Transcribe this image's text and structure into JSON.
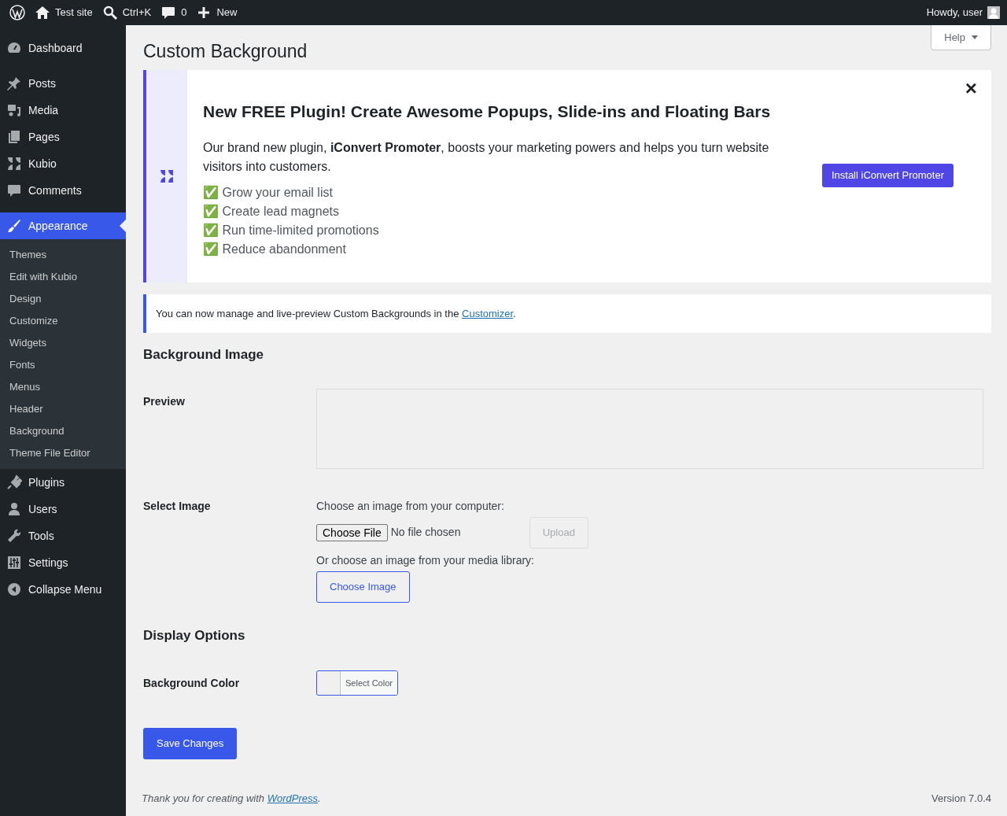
{
  "admin_bar": {
    "items": [
      {
        "kind": "logo"
      },
      {
        "kind": "home",
        "label": "Test site"
      },
      {
        "kind": "search",
        "label": "Ctrl+K"
      },
      {
        "kind": "comment",
        "label": "0"
      },
      {
        "kind": "plus",
        "label": "New"
      }
    ],
    "greeting": "Howdy, user"
  },
  "sidebar": {
    "items": [
      {
        "label": "Dashboard",
        "selected": false
      },
      {
        "label": "Posts",
        "selected": false
      },
      {
        "label": "Media",
        "selected": false
      },
      {
        "label": "Pages",
        "selected": false
      },
      {
        "label": "Kubio",
        "selected": false
      },
      {
        "label": "Comments",
        "selected": false
      },
      {
        "label": "Appearance",
        "selected": true,
        "submenu": [
          "Themes",
          "Edit with Kubio",
          "Design",
          "Customize",
          "Widgets",
          "Fonts",
          "Menus",
          "Header",
          "Background",
          "Theme File Editor"
        ]
      },
      {
        "label": "Plugins",
        "selected": false
      },
      {
        "label": "Users",
        "selected": false
      },
      {
        "label": "Tools",
        "selected": false
      },
      {
        "label": "Settings",
        "selected": false
      },
      {
        "label": "Collapse Menu",
        "selected": false
      }
    ]
  },
  "help_button": "Help",
  "page_title": "Custom Background",
  "promo": {
    "title": "New FREE Plugin! Create Awesome Popups, Slide-ins and Floating Bars",
    "body": "Our brand new plugin, **iConvert Promoter**, boosts your marketing powers and helps you turn website visitors into customers.",
    "bullets": [
      "✅ Grow your email list",
      "✅ Create lead magnets",
      "✅ Run time-limited promotions",
      "✅ Reduce abandonment"
    ],
    "button": "Install iConvert Promoter",
    "close": "×"
  },
  "notice": {
    "text": "You can now manage and live-preview Custom Backgrounds in the",
    "link": "Customizer",
    "after": "."
  },
  "background_image": {
    "heading": "Background Image",
    "preview_label": "Preview",
    "select_label": "Select Image",
    "computer_label": "Choose an image from your computer:",
    "file_button": "Choose File",
    "file_status": "No file chosen",
    "upload_button": "Upload",
    "library_label": "Or choose an image from your media library:",
    "choose_button": "Choose Image"
  },
  "display_options": {
    "heading": "Display Options",
    "color_label": "Background Color",
    "color_button": "Select Color"
  },
  "save_button": "Save Changes",
  "footer": {
    "text": "Thank you for creating with",
    "link": "WordPress",
    "after": ".",
    "version": "Version 7.0.4"
  }
}
